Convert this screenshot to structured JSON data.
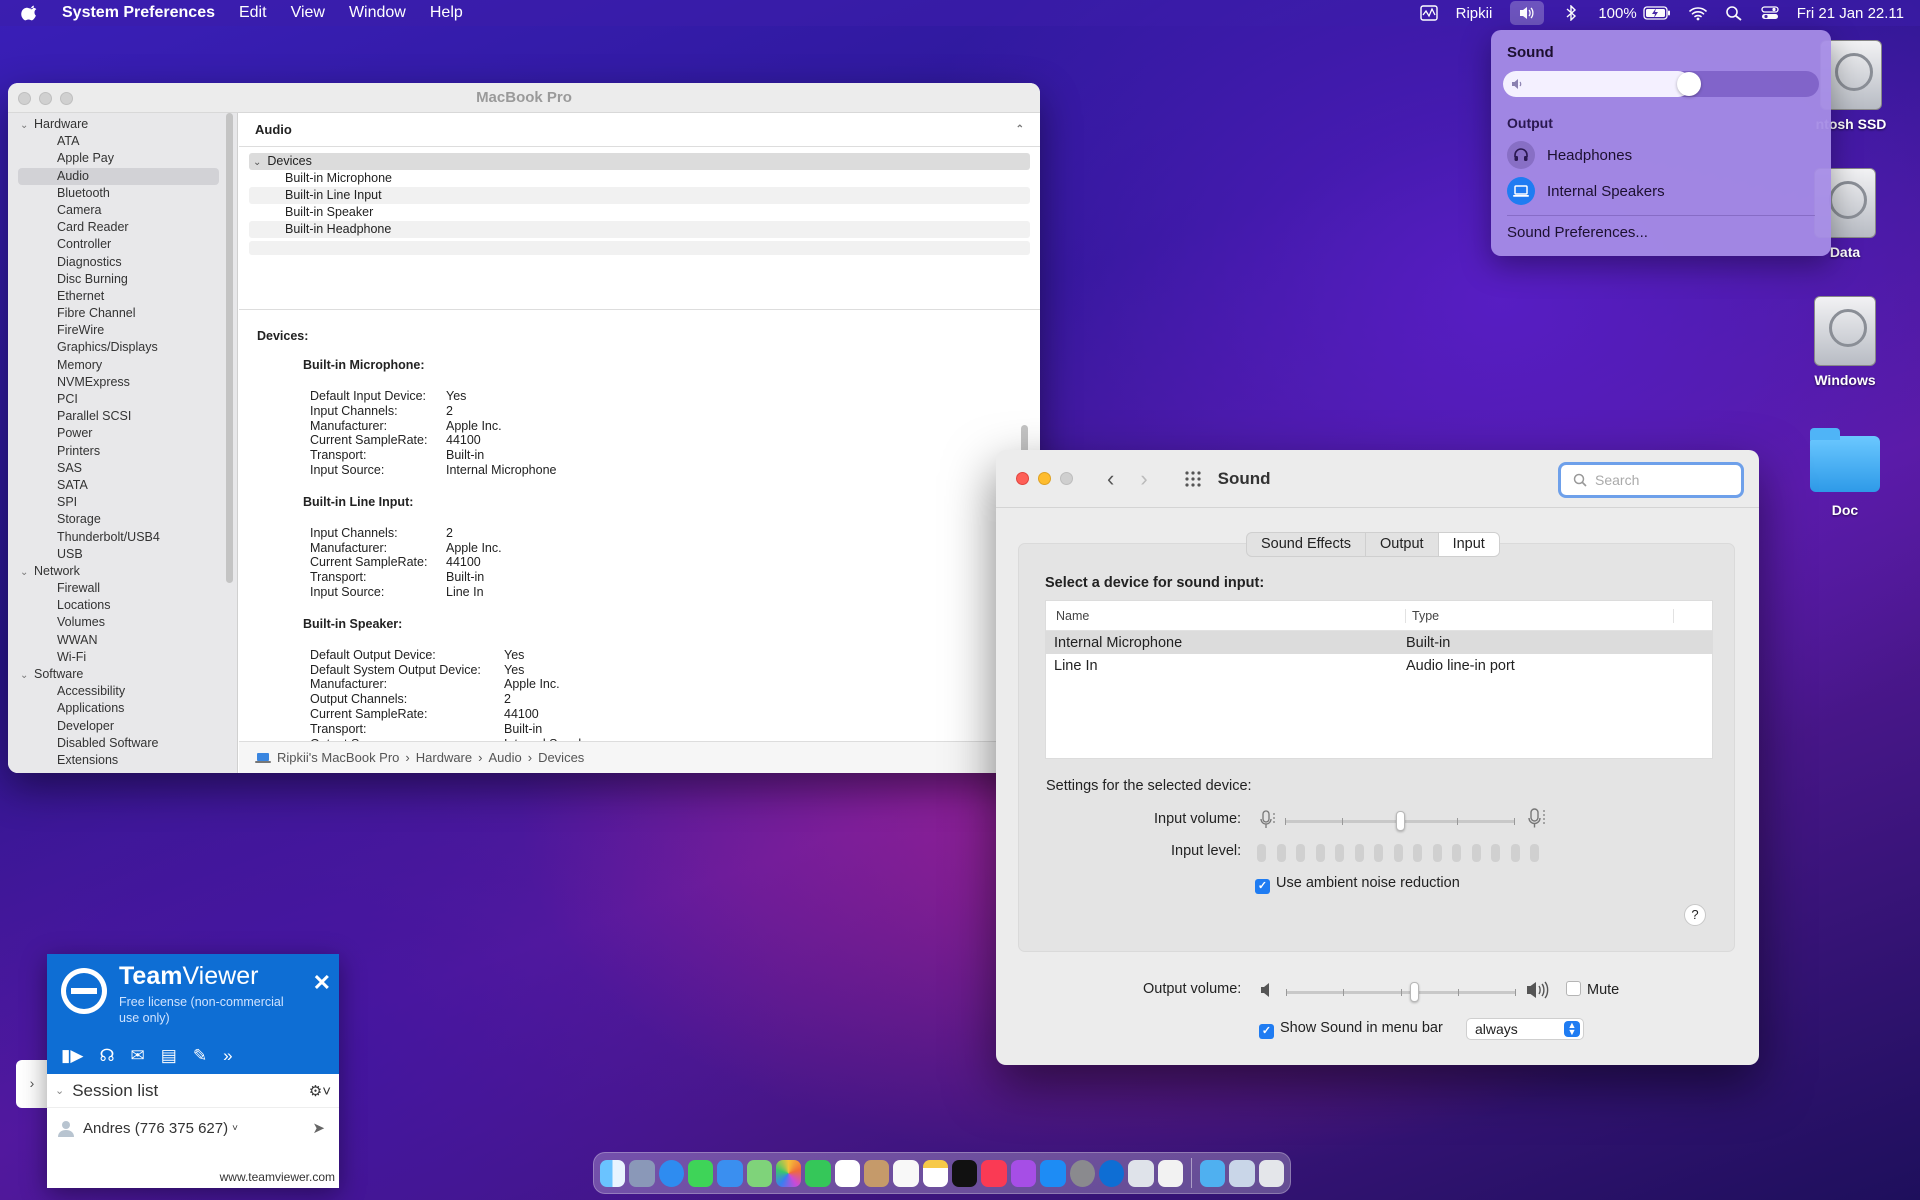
{
  "menubar": {
    "app_name": "System Preferences",
    "menus": [
      "Edit",
      "View",
      "Window",
      "Help"
    ],
    "user": "Ripkii",
    "battery": "100%",
    "datetime": "Fri 21 Jan  22.11"
  },
  "sound_menu": {
    "title": "Sound",
    "volume_fraction": 0.56,
    "output_label": "Output",
    "outputs": [
      {
        "label": "Headphones",
        "icon": "headphones-icon"
      },
      {
        "label": "Internal Speakers",
        "icon": "laptop-icon",
        "selected": true
      }
    ],
    "preferences_link": "Sound Preferences..."
  },
  "desktop": {
    "icons": [
      {
        "label": "ntosh SSD",
        "type": "disk"
      },
      {
        "label": "Data",
        "type": "disk"
      },
      {
        "label": "Windows",
        "type": "disk"
      },
      {
        "label": "Doc",
        "type": "folder"
      }
    ]
  },
  "sysinfo": {
    "title": "MacBook Pro",
    "sidebar": [
      {
        "kind": "group",
        "label": "Hardware"
      },
      {
        "kind": "item",
        "label": "ATA"
      },
      {
        "kind": "item",
        "label": "Apple Pay"
      },
      {
        "kind": "item",
        "label": "Audio",
        "selected": true
      },
      {
        "kind": "item",
        "label": "Bluetooth"
      },
      {
        "kind": "item",
        "label": "Camera"
      },
      {
        "kind": "item",
        "label": "Card Reader"
      },
      {
        "kind": "item",
        "label": "Controller"
      },
      {
        "kind": "item",
        "label": "Diagnostics"
      },
      {
        "kind": "item",
        "label": "Disc Burning"
      },
      {
        "kind": "item",
        "label": "Ethernet"
      },
      {
        "kind": "item",
        "label": "Fibre Channel"
      },
      {
        "kind": "item",
        "label": "FireWire"
      },
      {
        "kind": "item",
        "label": "Graphics/Displays"
      },
      {
        "kind": "item",
        "label": "Memory"
      },
      {
        "kind": "item",
        "label": "NVMExpress"
      },
      {
        "kind": "item",
        "label": "PCI"
      },
      {
        "kind": "item",
        "label": "Parallel SCSI"
      },
      {
        "kind": "item",
        "label": "Power"
      },
      {
        "kind": "item",
        "label": "Printers"
      },
      {
        "kind": "item",
        "label": "SAS"
      },
      {
        "kind": "item",
        "label": "SATA"
      },
      {
        "kind": "item",
        "label": "SPI"
      },
      {
        "kind": "item",
        "label": "Storage"
      },
      {
        "kind": "item",
        "label": "Thunderbolt/USB4"
      },
      {
        "kind": "item",
        "label": "USB"
      },
      {
        "kind": "group",
        "label": "Network"
      },
      {
        "kind": "item",
        "label": "Firewall"
      },
      {
        "kind": "item",
        "label": "Locations"
      },
      {
        "kind": "item",
        "label": "Volumes"
      },
      {
        "kind": "item",
        "label": "WWAN"
      },
      {
        "kind": "item",
        "label": "Wi-Fi"
      },
      {
        "kind": "group",
        "label": "Software"
      },
      {
        "kind": "item",
        "label": "Accessibility"
      },
      {
        "kind": "item",
        "label": "Applications"
      },
      {
        "kind": "item",
        "label": "Developer"
      },
      {
        "kind": "item",
        "label": "Disabled Software"
      },
      {
        "kind": "item",
        "label": "Extensions"
      }
    ],
    "header": "Audio",
    "tree_head": "Devices",
    "tree_items": [
      "Built-in Microphone",
      "Built-in Line Input",
      "Built-in Speaker",
      "Built-in Headphone"
    ],
    "detail_title": "Devices:",
    "devices": [
      {
        "name": "Built-in Microphone:",
        "props": [
          [
            "Default Input Device:",
            "Yes"
          ],
          [
            "Input Channels:",
            "2"
          ],
          [
            "Manufacturer:",
            "Apple Inc."
          ],
          [
            "Current SampleRate:",
            "44100"
          ],
          [
            "Transport:",
            "Built-in"
          ],
          [
            "Input Source:",
            "Internal Microphone"
          ]
        ]
      },
      {
        "name": "Built-in Line Input:",
        "props": [
          [
            "Input Channels:",
            "2"
          ],
          [
            "Manufacturer:",
            "Apple Inc."
          ],
          [
            "Current SampleRate:",
            "44100"
          ],
          [
            "Transport:",
            "Built-in"
          ],
          [
            "Input Source:",
            "Line In"
          ]
        ]
      },
      {
        "name": "Built-in Speaker:",
        "wide": true,
        "props": [
          [
            "Default Output Device:",
            "Yes"
          ],
          [
            "Default System Output Device:",
            "Yes"
          ],
          [
            "Manufacturer:",
            "Apple Inc."
          ],
          [
            "Output Channels:",
            "2"
          ],
          [
            "Current SampleRate:",
            "44100"
          ],
          [
            "Transport:",
            "Built-in"
          ],
          [
            "Output Source:",
            "Internal Speakers"
          ]
        ]
      }
    ],
    "path": [
      "Ripkii's MacBook Pro",
      "Hardware",
      "Audio",
      "Devices"
    ]
  },
  "sound_prefs": {
    "title": "Sound",
    "search_placeholder": "Search",
    "tabs": [
      "Sound Effects",
      "Output",
      "Input"
    ],
    "active_tab": "Input",
    "select_label": "Select a device for sound input:",
    "columns": [
      "Name",
      "Type"
    ],
    "rows": [
      {
        "name": "Internal Microphone",
        "type": "Built-in",
        "selected": true
      },
      {
        "name": "Line In",
        "type": "Audio line-in port"
      }
    ],
    "settings_label": "Settings for the selected device:",
    "input_volume_label": "Input volume:",
    "input_volume": 0.5,
    "input_level_label": "Input level:",
    "noise_reduction_label": "Use ambient noise reduction",
    "noise_reduction": true,
    "help": "?",
    "output_volume_label": "Output volume:",
    "output_volume": 0.56,
    "mute_label": "Mute",
    "mute": false,
    "show_in_menubar_label": "Show Sound in menu bar",
    "show_in_menubar": true,
    "menubar_option": "always"
  },
  "teamviewer": {
    "brand_bold": "Team",
    "brand_rest": "Viewer",
    "license": "Free license (non-commercial use only)",
    "session_list": "Session list",
    "contact": "Andres (776 375 627)",
    "url": "www.teamviewer.com"
  },
  "colors": {
    "accent": "#1f7cf2",
    "teamviewer_blue": "#0e6ed4",
    "close_red": "#fe5f57",
    "minimize_yellow": "#febc2e"
  }
}
